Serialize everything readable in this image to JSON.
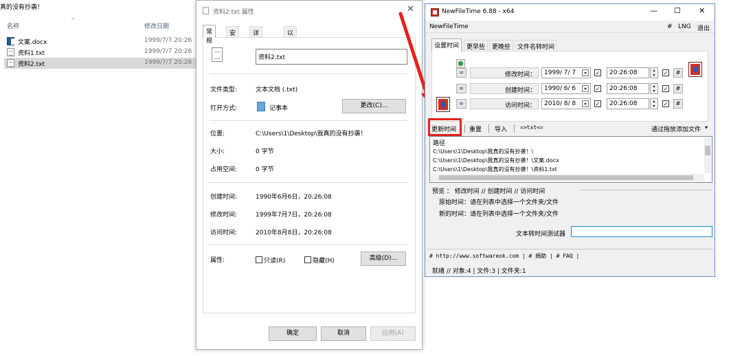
{
  "explorer": {
    "title": "真的没有抄袭！",
    "col_name": "名称",
    "col_date": "修改日期",
    "sort_indicator": "^",
    "files": [
      {
        "name": "文案.docx",
        "date": "1999/7/7 20:26",
        "icon": "word-doc-icon"
      },
      {
        "name": "资料1.txt",
        "date": "1999/7/7 20:26",
        "icon": "text-file-icon"
      },
      {
        "name": "资料2.txt",
        "date": "1999/7/7 20:26",
        "icon": "text-file-icon"
      }
    ]
  },
  "props": {
    "title": "资料2.txt 属性",
    "close": "✕",
    "tabs": [
      "常规",
      "安全",
      "详细信息",
      "以前的版本"
    ],
    "file_name": "资料2.txt",
    "type_label": "文件类型:",
    "type_value": "文本文档 (.txt)",
    "open_label": "打开方式:",
    "open_value": "记事本",
    "change_btn": "更改(C)...",
    "location_label": "位置:",
    "location_value": "C:\\Users\\1\\Desktop\\我真的没有抄袭！",
    "size_label": "大小:",
    "size_value": "0 字节",
    "disk_label": "占用空间:",
    "disk_value": "0 字节",
    "created_label": "创建时间:",
    "created_value": "1990年6月6日，20:26:08",
    "modified_label": "修改时间:",
    "modified_value": "1999年7月7日，20:26:08",
    "accessed_label": "访问时间:",
    "accessed_value": "2010年8月8日，20:26:08",
    "attr_label": "属性:",
    "readonly_label": "只读(R)",
    "hidden_label": "隐藏(H)",
    "advanced_btn": "高级(D)...",
    "ok_btn": "确定",
    "cancel_btn": "取消",
    "apply_btn": "应用(A)"
  },
  "nft": {
    "title": "NewFileTime 6.88 - x64",
    "minimize": "—",
    "maximize": "☐",
    "close": "✕",
    "menu_app": "NewFileTime",
    "menu_hash": "#",
    "menu_lng": "LNG",
    "menu_exit": "退出",
    "tabs": [
      "设置时间",
      "更早些",
      "更晚些",
      "文件名转时间"
    ],
    "eq": "=",
    "hash_btn": "#",
    "rows": [
      {
        "label": "修改时间：",
        "date": "1999/ 7/ 7",
        "time": "20:26:08"
      },
      {
        "label": "创建时间：",
        "date": "1990/ 6/ 6",
        "time": "20:26:08"
      },
      {
        "label": "访问时间：",
        "date": "2010/ 8/ 8",
        "time": "20:26:08"
      }
    ],
    "check": "✓",
    "toolbar": {
      "update": "更新时间",
      "reset": "重置",
      "import": "导入",
      "txt": "=>txt<=",
      "drag": "通过拖放添加文件"
    },
    "list_header": "路径",
    "list_rows": [
      "C:\\Users\\1\\Desktop\\我真的没有抄袭！\\",
      "C:\\Users\\1\\Desktop\\我真的没有抄袭！\\文案.docx",
      "C:\\Users\\1\\Desktop\\我真的没有抄袭！\\资料1.txt"
    ],
    "preview_header": "预览 ：  修改时间   //   创建时间   //   访问时间",
    "orig_time": "原始时间：请在列表中选择一个文件夹/文件",
    "new_time": "新的时间：请在列表中选择一个文件夹/文件",
    "test_label": "文本转时间测试器",
    "test_value": "",
    "links": "# http://www.softwareok.com  |  # 捐助  |  # FAQ  |",
    "status": "就绪 // 对象:4 | 文件:3  | 文件夹:1"
  },
  "colors": {
    "accent_red": "#e3221b",
    "selection": "#d9d9d9",
    "focus_blue": "#1c8ad6"
  }
}
